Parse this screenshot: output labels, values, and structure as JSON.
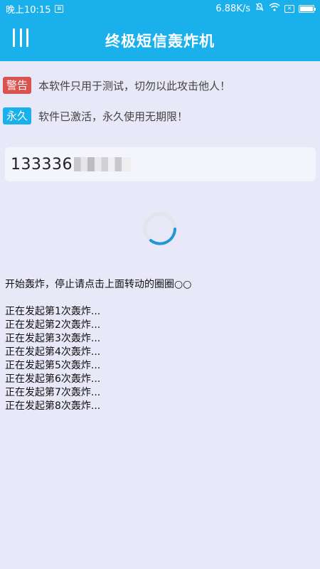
{
  "status": {
    "time": "晚上10:15",
    "speed": "6.88K/s"
  },
  "app": {
    "title": "终极短信轰炸机"
  },
  "notices": [
    {
      "badge": "警告",
      "text": "本软件只用于测试，切勿以此攻击他人！",
      "color": "#d9534f"
    },
    {
      "badge": "永久",
      "text": "软件已激活，永久使用无期限！",
      "color": "#1ab0ec"
    }
  ],
  "phone": {
    "visible_prefix": "133336"
  },
  "log": {
    "header": "开始轰炸，停止请点击上面转动的圈圈○○",
    "lines": [
      "正在发起第1次轰炸...",
      "正在发起第2次轰炸...",
      "正在发起第3次轰炸...",
      "正在发起第4次轰炸...",
      "正在发起第5次轰炸...",
      "正在发起第6次轰炸...",
      "正在发起第7次轰炸...",
      "正在发起第8次轰炸..."
    ]
  },
  "icons": [
    "menu-icon",
    "mute-icon",
    "wifi-icon",
    "sim-icon",
    "battery-icon",
    "spinner-icon"
  ],
  "colors": {
    "accent": "#1ab0ec",
    "background": "#e8e8f8",
    "warning": "#d9534f"
  }
}
